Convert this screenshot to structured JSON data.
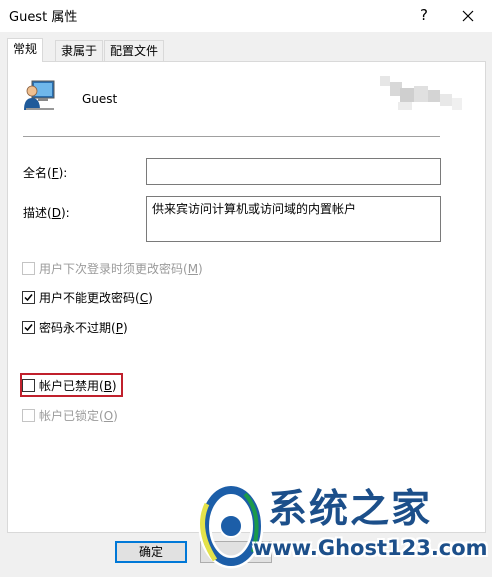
{
  "window": {
    "title": "Guest 属性",
    "help_glyph": "?",
    "close_icon": "close-icon"
  },
  "tabs": [
    {
      "label": "常规",
      "active": true
    },
    {
      "label": "隶属于",
      "active": false
    },
    {
      "label": "配置文件",
      "active": false
    }
  ],
  "user": {
    "name": "Guest",
    "icon": "user-account-icon"
  },
  "form": {
    "fullname": {
      "label_pre": "全名(",
      "accel": "F",
      "label_post": "):",
      "value": ""
    },
    "description": {
      "label_pre": "描述(",
      "accel": "D",
      "label_post": "):",
      "value": "供来宾访问计算机或访问域的内置帐户"
    }
  },
  "checkboxes": [
    {
      "label_pre": "用户下次登录时须更改密码(",
      "accel": "M",
      "label_post": ")",
      "checked": false,
      "enabled": false
    },
    {
      "label_pre": "用户不能更改密码(",
      "accel": "C",
      "label_post": ")",
      "checked": true,
      "enabled": true
    },
    {
      "label_pre": "密码永不过期(",
      "accel": "P",
      "label_post": ")",
      "checked": true,
      "enabled": true
    },
    {
      "label_pre": "帐户已禁用(",
      "accel": "B",
      "label_post": ")",
      "checked": false,
      "enabled": true,
      "highlighted": true
    },
    {
      "label_pre": "帐户已锁定(",
      "accel": "O",
      "label_post": ")",
      "checked": false,
      "enabled": false
    }
  ],
  "buttons": {
    "ok": "确定"
  },
  "watermark": {
    "title": "系统之家",
    "url": "www.Ghost123.com"
  },
  "colors": {
    "highlight": "#c0202c",
    "accent": "#0078d7",
    "watermark": "#1c4f8a"
  }
}
